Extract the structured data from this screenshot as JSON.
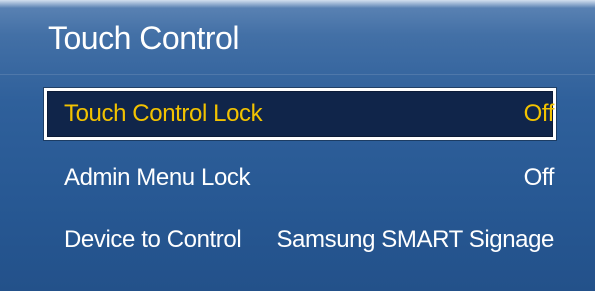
{
  "menu": {
    "title": "Touch Control",
    "items": [
      {
        "label": "Touch Control Lock",
        "value": "Off",
        "selected": true
      },
      {
        "label": "Admin Menu Lock",
        "value": "Off",
        "selected": false
      },
      {
        "label": "Device to Control",
        "value": "Samsung SMART Signage",
        "selected": false
      }
    ]
  },
  "colors": {
    "panel_blue": "#2f609b",
    "highlight_text": "#f2c200",
    "highlight_bg": "#10254a",
    "text": "#ffffff"
  }
}
